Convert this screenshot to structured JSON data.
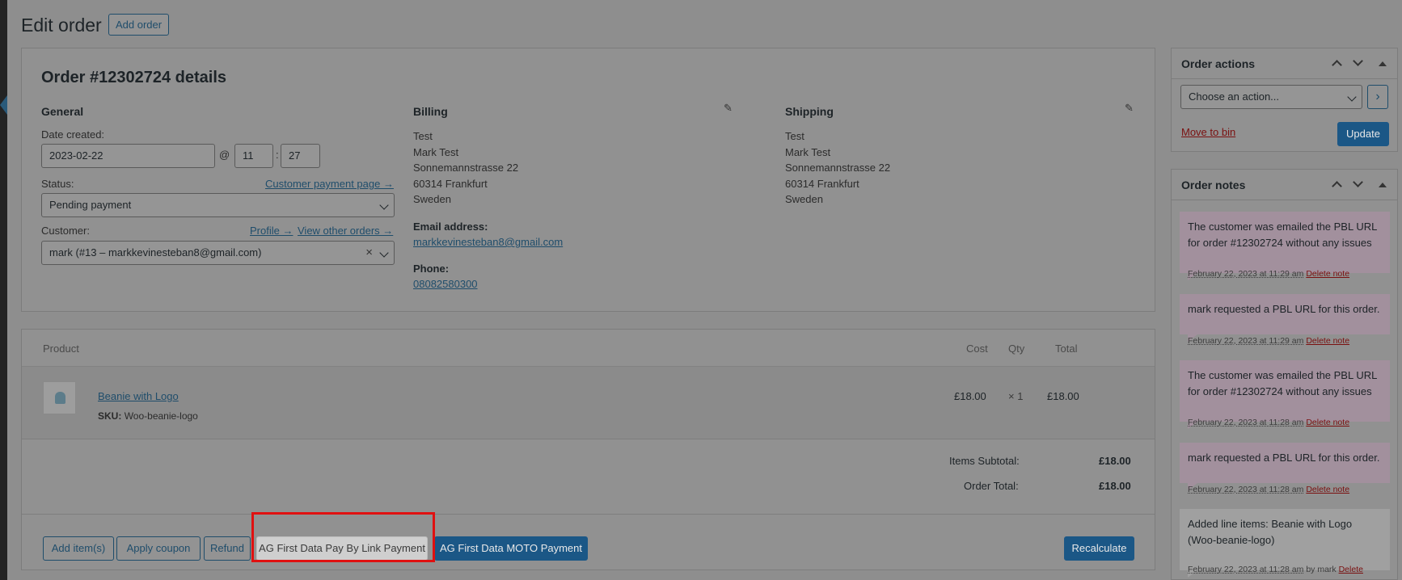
{
  "page": {
    "title": "Edit order",
    "add_order_label": "Add order"
  },
  "order": {
    "heading": "Order #12302724 details",
    "general": {
      "title": "General",
      "date_label": "Date created:",
      "date_value": "2023-02-22",
      "at_symbol": "@",
      "hour": "11",
      "colon": ":",
      "minute": "27",
      "status_label": "Status:",
      "customer_payment_link": "Customer payment page →",
      "status_value": "Pending payment",
      "customer_label": "Customer:",
      "profile_link": "Profile →",
      "other_orders_link": "View other orders →",
      "customer_value": "mark (#13 – markkevinesteban8@gmail.com)",
      "clear_symbol": "×"
    },
    "billing": {
      "title": "Billing",
      "address_lines": [
        "Test",
        "Mark Test",
        "Sonnemannstrasse 22",
        "60314 Frankfurt",
        "Sweden"
      ],
      "email_label": "Email address:",
      "email": "markkevinesteban8@gmail.com",
      "phone_label": "Phone:",
      "phone": "08082580300"
    },
    "shipping": {
      "title": "Shipping",
      "address_lines": [
        "Test",
        "Mark Test",
        "Sonnemannstrasse 22",
        "60314 Frankfurt",
        "Sweden"
      ]
    },
    "edit_icon": "✎"
  },
  "items": {
    "headers": {
      "product": "Product",
      "cost": "Cost",
      "qty": "Qty",
      "total": "Total"
    },
    "rows": [
      {
        "name": "Beanie with Logo",
        "sku_label": "SKU:",
        "sku": "Woo-beanie-logo",
        "cost": "£18.00",
        "qty": "× 1",
        "total": "£18.00"
      }
    ],
    "subtotal_label": "Items Subtotal:",
    "subtotal_value": "£18.00",
    "order_total_label": "Order Total:",
    "order_total_value": "£18.00",
    "buttons": {
      "add_items": "Add item(s)",
      "apply_coupon": "Apply coupon",
      "refund": "Refund",
      "pay_by_link": "AG First Data Pay By Link Payment",
      "moto": "AG First Data MOTO Payment",
      "recalculate": "Recalculate"
    }
  },
  "order_actions": {
    "title": "Order actions",
    "select_value": "Choose an action...",
    "go_symbol": "›",
    "move_to_bin": "Move to bin",
    "update": "Update"
  },
  "order_notes": {
    "title": "Order notes",
    "notes": [
      {
        "text": "The customer was emailed the PBL URL for order #12302724 without any issues",
        "date": "February 22, 2023 at 11:29 am",
        "by": "",
        "delete": "Delete note"
      },
      {
        "text": "mark requested a PBL URL for this order.",
        "date": "February 22, 2023 at 11:29 am",
        "by": "",
        "delete": "Delete note"
      },
      {
        "text": "The customer was emailed the PBL URL for order #12302724 without any issues",
        "date": "February 22, 2023 at 11:28 am",
        "by": "",
        "delete": "Delete note"
      },
      {
        "text": "mark requested a PBL URL for this order.",
        "date": "February 22, 2023 at 11:28 am",
        "by": "",
        "delete": "Delete note"
      },
      {
        "text": "Added line items: Beanie with Logo (Woo-beanie-logo)",
        "date": "February 22, 2023 at 11:28 am",
        "by": "by mark",
        "delete": "Delete"
      }
    ]
  }
}
